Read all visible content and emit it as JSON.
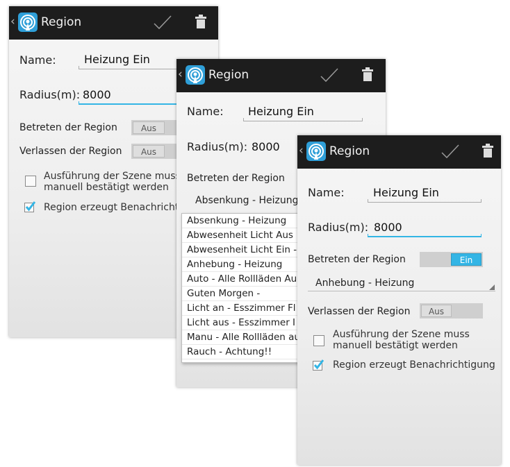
{
  "app": {
    "title": "Region"
  },
  "labels": {
    "name": "Name:",
    "radius": "Radius(m):",
    "enter_region": "Betreten der Region",
    "leave_region": "Verlassen der Region",
    "confirm_line1": "Ausführung der Szene muss",
    "confirm_line2": "manuell bestätigt werden",
    "notify": "Region erzeugt Benachrichtigung"
  },
  "form": {
    "name_value": "Heizung Ein",
    "radius_value": "8000"
  },
  "toggles": {
    "off_label": "Aus",
    "on_label": "Ein"
  },
  "screen1": {
    "enter_state": "Aus",
    "leave_state": "Aus",
    "confirm_checked": false,
    "notify_checked": true
  },
  "screen2": {
    "enter_scene": "Absenkung - Heizung",
    "scene_options": [
      "Absenkung - Heizung",
      "Abwesenheit Licht Aus",
      "Abwesenheit Licht Ein -",
      "Anhebung - Heizung",
      "Auto - Alle Rollläden Au",
      "Guten Morgen -",
      "Licht an - Esszimmer Fl",
      "Licht aus - Esszimmer I",
      "Manu - Alle Rollläden au",
      "Rauch - Achtung!!"
    ]
  },
  "screen3": {
    "enter_state": "Ein",
    "enter_scene": "Anhebung - Heizung",
    "leave_state": "Aus",
    "confirm_checked": false,
    "notify_checked": true
  },
  "icons": {
    "app": "region-app-icon",
    "confirm": "checkmark-icon",
    "delete": "trash-icon",
    "back": "back-caret-icon"
  },
  "colors": {
    "accent": "#33b5e5",
    "actionbar": "#1d1d1d",
    "checkbox": "#33b5e5"
  }
}
